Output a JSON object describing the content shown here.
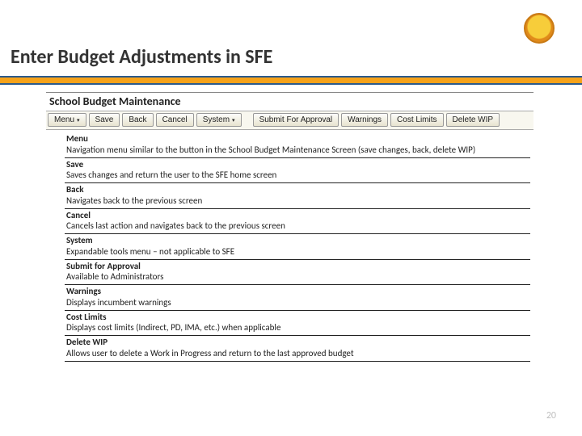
{
  "logo": {
    "name": "circular school logo"
  },
  "title": "Enter Budget Adjustments in SFE",
  "app": {
    "header": "School Budget Maintenance",
    "toolbar_group1": [
      {
        "label": "Menu",
        "chev": "▾"
      },
      {
        "label": "Save"
      },
      {
        "label": "Back"
      },
      {
        "label": "Cancel"
      },
      {
        "label": "System",
        "chev": "▾"
      }
    ],
    "toolbar_group2": [
      {
        "label": "Submit For Approval"
      },
      {
        "label": "Warnings"
      },
      {
        "label": "Cost Limits"
      },
      {
        "label": "Delete WIP"
      }
    ]
  },
  "rows": [
    {
      "label": "Menu",
      "desc": "Navigation menu similar to the button in the School Budget Maintenance Screen (save changes, back, delete WIP)"
    },
    {
      "label": "Save",
      "desc": "Saves changes and return the user to the SFE home screen"
    },
    {
      "label": "Back",
      "desc": "Navigates back to the previous screen"
    },
    {
      "label": "Cancel",
      "desc": "Cancels last action and navigates back to the previous screen"
    },
    {
      "label": "System",
      "desc": "Expandable tools menu – not applicable to SFE"
    },
    {
      "label": "Submit for Approval",
      "desc": " Available to Administrators"
    },
    {
      "label": "Warnings",
      "desc": "Displays incumbent warnings"
    },
    {
      "label": "Cost Limits",
      "desc": "Displays cost limits (Indirect, PD, IMA, etc.) when applicable"
    },
    {
      "label": "Delete WIP",
      "desc": "Allows user to delete a Work in Progress and return to the last approved budget"
    }
  ],
  "page_number": "20"
}
